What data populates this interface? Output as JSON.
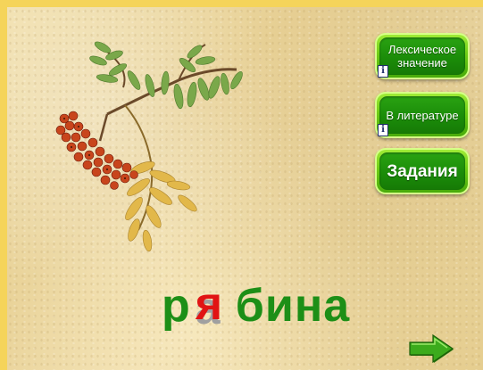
{
  "buttons": {
    "lexical_meaning": "Лексическое значение",
    "in_literature": "В литературе",
    "tasks": "Задания",
    "info_glyph": "i"
  },
  "word": {
    "prefix": "р",
    "missing_letter_hint": "а",
    "inserted_letter": "я",
    "suffix": "бина"
  },
  "icons": {
    "info": "info-icon",
    "next": "right-arrow-icon",
    "illustration": "rowan-branch-illustration"
  },
  "colors": {
    "accent_green": "#1d8f17",
    "highlight_red": "#e11414",
    "border_yellow": "#f5d45a"
  }
}
